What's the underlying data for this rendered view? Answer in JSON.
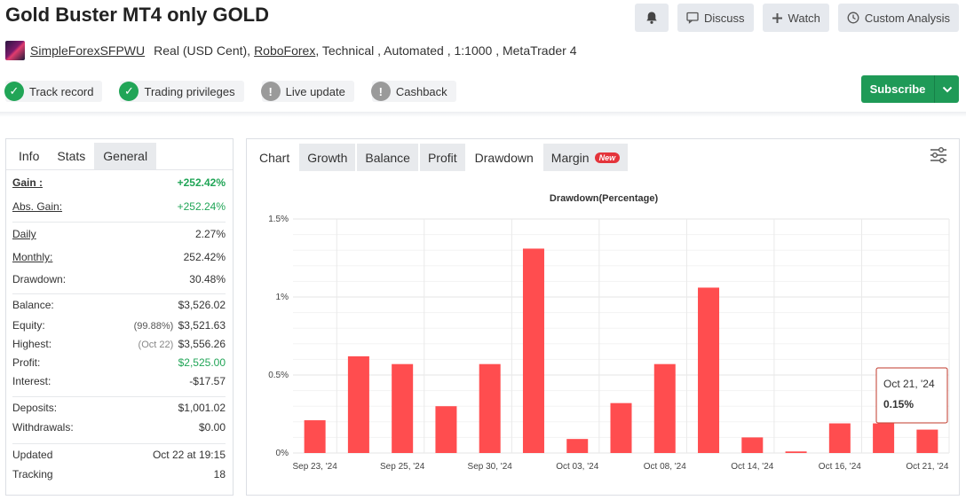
{
  "page_title": "Gold Buster MT4 only GOLD",
  "top_actions": {
    "discuss": "Discuss",
    "watch": "Watch",
    "custom_analysis": "Custom Analysis"
  },
  "subline": {
    "user": "SimpleForexSFPWU",
    "account": "Real (USD Cent),",
    "broker": "RoboForex",
    "rest": ", Technical , Automated , 1:1000 , MetaTrader 4"
  },
  "badges": [
    {
      "label": "Track record",
      "status": "ok"
    },
    {
      "label": "Trading privileges",
      "status": "ok"
    },
    {
      "label": "Live update",
      "status": "warn"
    },
    {
      "label": "Cashback",
      "status": "warn"
    }
  ],
  "subscribe_label": "Subscribe",
  "left_tabs": [
    "Info",
    "Stats",
    "General"
  ],
  "stats": {
    "gain": {
      "label": "Gain :",
      "value": "+252.42%"
    },
    "abs_gain": {
      "label": "Abs. Gain:",
      "value": "+252.24%"
    },
    "daily": {
      "label": "Daily",
      "value": "2.27%"
    },
    "monthly": {
      "label": "Monthly:",
      "value": "252.42%"
    },
    "drawdown": {
      "label": "Drawdown:",
      "value": "30.48%"
    },
    "balance": {
      "label": "Balance:",
      "value": "$3,526.02"
    },
    "equity": {
      "label": "Equity:",
      "note": "(99.88%)",
      "value": "$3,521.63"
    },
    "highest": {
      "label": "Highest:",
      "note": "(Oct 22)",
      "value": "$3,556.26"
    },
    "profit": {
      "label": "Profit:",
      "value": "$2,525.00"
    },
    "interest": {
      "label": "Interest:",
      "value": "-$17.57"
    },
    "deposits": {
      "label": "Deposits:",
      "value": "$1,001.02"
    },
    "withdrawals": {
      "label": "Withdrawals:",
      "value": "$0.00"
    },
    "updated": {
      "label": "Updated",
      "value": "Oct 22 at 19:15"
    },
    "tracking": {
      "label": "Tracking",
      "value": "18"
    }
  },
  "chart_tabs": [
    "Chart",
    "Growth",
    "Balance",
    "Profit",
    "Drawdown",
    "Margin"
  ],
  "new_badge": "New",
  "colors": {
    "accent_green": "#21a557",
    "bar_red": "#ff4d4f",
    "subscribe_green": "#1f9a57"
  },
  "chart_data": {
    "type": "bar",
    "title": "Drawdown(Percentage)",
    "ylim": [
      0,
      1.5
    ],
    "y_ticks": [
      "0%",
      "0.5%",
      "1%",
      "1.5%"
    ],
    "x_tick_labels": [
      "Sep 23, '24",
      "Sep 25, '24",
      "Sep 30, '24",
      "Oct 03, '24",
      "Oct 08, '24",
      "Oct 14, '24",
      "Oct 16, '24",
      "Oct 21, '24"
    ],
    "values": [
      0.21,
      0.62,
      0.57,
      0.3,
      0.57,
      1.31,
      0.09,
      0.32,
      0.57,
      1.06,
      0.1,
      0.01,
      0.19,
      0.19,
      0.15
    ],
    "tooltip": {
      "date": "Oct 21, '24",
      "value": "0.15%"
    },
    "grid": true
  }
}
